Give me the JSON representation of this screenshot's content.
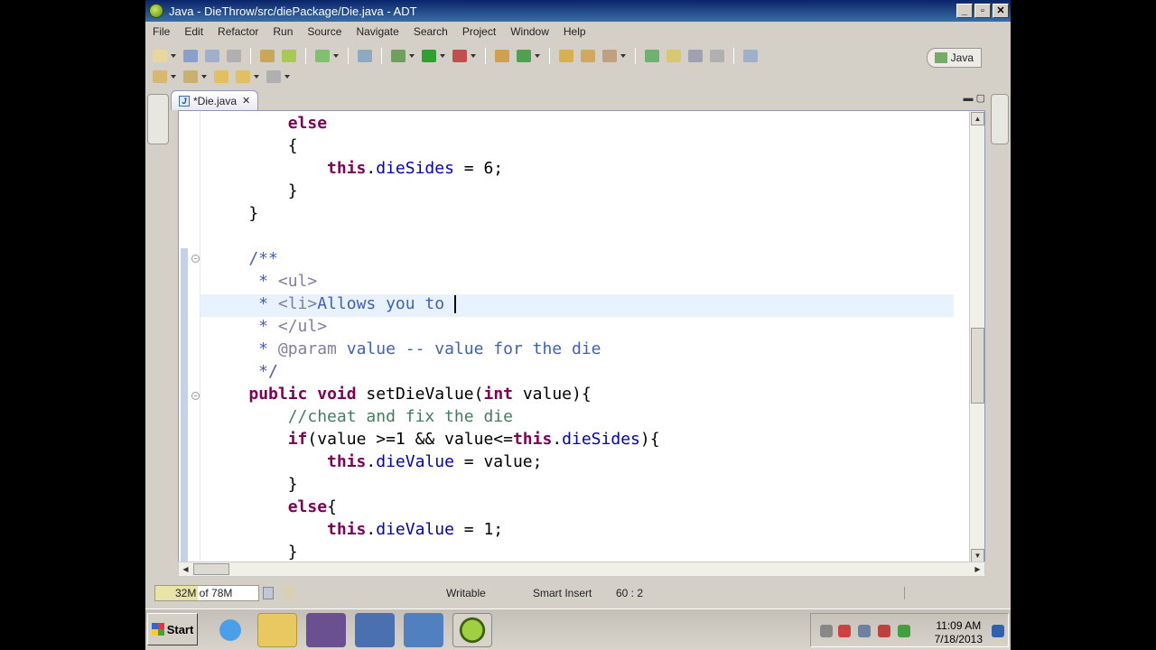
{
  "window": {
    "title": "Java - DieThrow/src/diePackage/Die.java - ADT",
    "btn_min": "_",
    "btn_max": "▫",
    "btn_close": "✕"
  },
  "menu": [
    "File",
    "Edit",
    "Refactor",
    "Run",
    "Source",
    "Navigate",
    "Search",
    "Project",
    "Window",
    "Help"
  ],
  "perspective": {
    "label": "Java"
  },
  "editor": {
    "tab_label": "*Die.java",
    "lines": [
      {
        "parts": [
          {
            "t": "        ",
            "c": ""
          },
          {
            "t": "else",
            "c": "kw"
          }
        ]
      },
      {
        "parts": [
          {
            "t": "        {",
            "c": ""
          }
        ]
      },
      {
        "parts": [
          {
            "t": "            ",
            "c": ""
          },
          {
            "t": "this",
            "c": "kw"
          },
          {
            "t": ".",
            "c": ""
          },
          {
            "t": "dieSides",
            "c": "fld"
          },
          {
            "t": " = 6;",
            "c": ""
          }
        ]
      },
      {
        "parts": [
          {
            "t": "        }",
            "c": ""
          }
        ]
      },
      {
        "parts": [
          {
            "t": "    }",
            "c": ""
          }
        ]
      },
      {
        "parts": [
          {
            "t": "",
            "c": ""
          }
        ]
      },
      {
        "parts": [
          {
            "t": "    /**",
            "c": "doc"
          }
        ]
      },
      {
        "parts": [
          {
            "t": "     * ",
            "c": "doc"
          },
          {
            "t": "<ul>",
            "c": "tag"
          }
        ]
      },
      {
        "parts": [
          {
            "t": "     * ",
            "c": "doc"
          },
          {
            "t": "<li>",
            "c": "tag"
          },
          {
            "t": "Allows you to ",
            "c": "doc"
          }
        ],
        "caret": true
      },
      {
        "parts": [
          {
            "t": "     * ",
            "c": "doc"
          },
          {
            "t": "</ul>",
            "c": "tag"
          }
        ]
      },
      {
        "parts": [
          {
            "t": "     * ",
            "c": "doc"
          },
          {
            "t": "@param",
            "c": "tag"
          },
          {
            "t": " value -- value for the die",
            "c": "doc"
          }
        ]
      },
      {
        "parts": [
          {
            "t": "     */",
            "c": "doc"
          }
        ]
      },
      {
        "parts": [
          {
            "t": "    ",
            "c": ""
          },
          {
            "t": "public",
            "c": "kw"
          },
          {
            "t": " ",
            "c": ""
          },
          {
            "t": "void",
            "c": "kw"
          },
          {
            "t": " setDieValue(",
            "c": ""
          },
          {
            "t": "int",
            "c": "kw"
          },
          {
            "t": " value){",
            "c": ""
          }
        ]
      },
      {
        "parts": [
          {
            "t": "        ",
            "c": ""
          },
          {
            "t": "//cheat and fix the die",
            "c": "cmt"
          }
        ]
      },
      {
        "parts": [
          {
            "t": "        ",
            "c": ""
          },
          {
            "t": "if",
            "c": "kw"
          },
          {
            "t": "(value >=1 && value<=",
            "c": ""
          },
          {
            "t": "this",
            "c": "kw"
          },
          {
            "t": ".",
            "c": ""
          },
          {
            "t": "dieSides",
            "c": "fld"
          },
          {
            "t": "){",
            "c": ""
          }
        ]
      },
      {
        "parts": [
          {
            "t": "            ",
            "c": ""
          },
          {
            "t": "this",
            "c": "kw"
          },
          {
            "t": ".",
            "c": ""
          },
          {
            "t": "dieValue",
            "c": "fld"
          },
          {
            "t": " = value;",
            "c": ""
          }
        ]
      },
      {
        "parts": [
          {
            "t": "        }",
            "c": ""
          }
        ]
      },
      {
        "parts": [
          {
            "t": "        ",
            "c": ""
          },
          {
            "t": "else",
            "c": "kw"
          },
          {
            "t": "{",
            "c": ""
          }
        ]
      },
      {
        "parts": [
          {
            "t": "            ",
            "c": ""
          },
          {
            "t": "this",
            "c": "kw"
          },
          {
            "t": ".",
            "c": ""
          },
          {
            "t": "dieValue",
            "c": "fld"
          },
          {
            "t": " = 1;",
            "c": ""
          }
        ]
      },
      {
        "parts": [
          {
            "t": "        }",
            "c": ""
          }
        ]
      }
    ]
  },
  "status": {
    "heap": "32M of 78M",
    "heap_fraction": 0.41,
    "writable": "Writable",
    "insert_mode": "Smart Insert",
    "position": "60 : 2"
  },
  "taskbar": {
    "start": "Start",
    "time": "11:09 AM",
    "date": "7/18/2013"
  },
  "icons": [
    "eclipse-adt-icon",
    "ie-icon",
    "folder-icon",
    "visual-studio-icon",
    "network-icon",
    "adt-icon"
  ]
}
